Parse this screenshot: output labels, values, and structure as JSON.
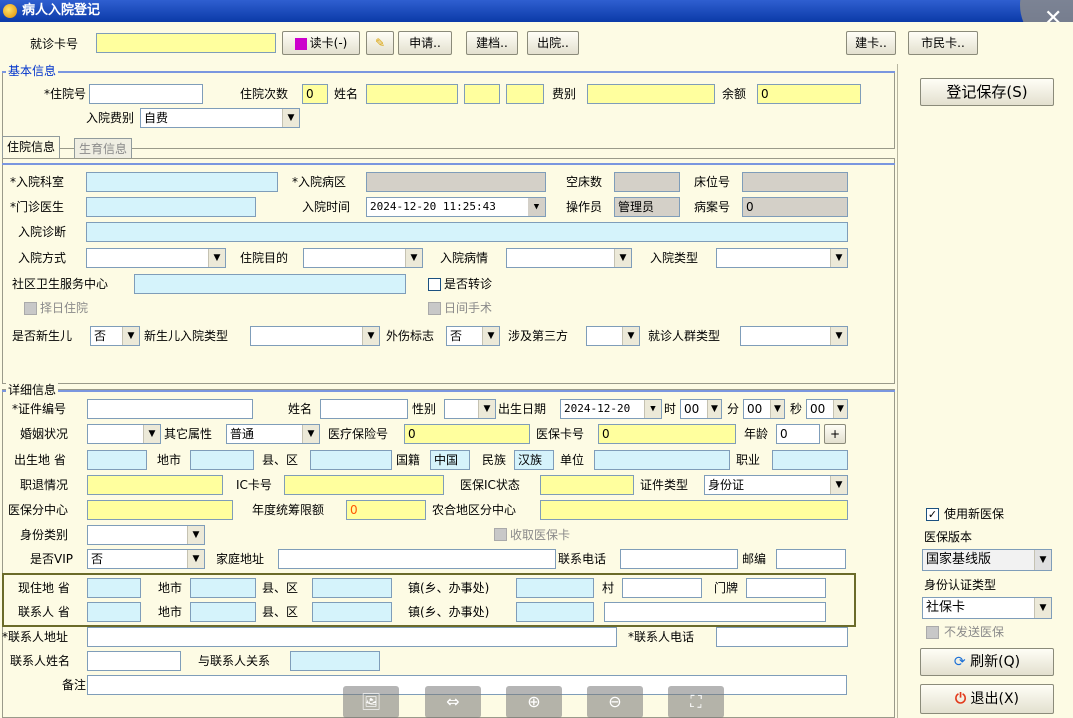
{
  "window": {
    "title": "病人入院登记"
  },
  "top": {
    "card_label": "就诊卡号",
    "card_value": "",
    "read_card": "读卡(-)",
    "apply": "申请..",
    "create_file": "建档..",
    "discharge": "出院..",
    "create_card": "建卡..",
    "citizen_card": "市民卡.."
  },
  "basic": {
    "title": "基本信息",
    "inpatient_no_label": "*住院号",
    "inpatient_no": "",
    "times_label": "住院次数",
    "times": "0",
    "name_label": "姓名",
    "fee_label": "费别",
    "balance_label": "余额",
    "balance": "0",
    "admit_fee_label": "入院费别",
    "admit_fee": "自费"
  },
  "tabs": {
    "hosp": "住院信息",
    "birth": "生育信息"
  },
  "hosp": {
    "dept": "*入院科室",
    "ward": "*入院病区",
    "empty_beds": "空床数",
    "bed_no": "床位号",
    "doctor": "*门诊医生",
    "admit_time_label": "入院时间",
    "admit_time": "2024-12-20 11:25:43",
    "operator_label": "操作员",
    "operator": "管理员",
    "case_no_label": "病案号",
    "case_no": "0",
    "diagnosis": "入院诊断",
    "admit_way": "入院方式",
    "purpose": "住院目的",
    "condition": "入院病情",
    "admit_type": "入院类型",
    "community": "社区卫生服务中心",
    "transfer": "是否转诊",
    "select_day": "择日住院",
    "day_surgery": "日间手术",
    "newborn_label": "是否新生儿",
    "newborn": "否",
    "newborn_type": "新生儿入院类型",
    "injury_label": "外伤标志",
    "injury": "否",
    "third_party": "涉及第三方",
    "crowd_type": "就诊人群类型"
  },
  "detail": {
    "title": "详细信息",
    "cert_no": "*证件编号",
    "name": "姓名",
    "sex": "性别",
    "birth_label": "出生日期",
    "birth": "2024-12-20",
    "hour_label": "时",
    "hour": "00",
    "min_label": "分",
    "min": "00",
    "sec_label": "秒",
    "sec": "00",
    "marital": "婚姻状况",
    "other_attr": "其它属性",
    "other_attr_val": "普通",
    "insurance_no_label": "医疗保险号",
    "insurance_no": "0",
    "card_no_label": "医保卡号",
    "card_no": "0",
    "age_label": "年龄",
    "age": "0",
    "birthplace": "出生地 省",
    "city": "地市",
    "county": "县、区",
    "nation_label": "国籍",
    "nation": "中国",
    "ethnic_label": "民族",
    "ethnic": "汉族",
    "unit": "单位",
    "job": "职业",
    "retire": "职退情况",
    "ic_no": "IC卡号",
    "ic_state": "医保IC状态",
    "cert_type_label": "证件类型",
    "cert_type": "身份证",
    "ins_center": "医保分中心",
    "annual": "年度统筹限额",
    "annual_val": "0",
    "rural_center": "农合地区分中心",
    "id_cat": "身份类别",
    "collect_card": "收取医保卡",
    "vip_label": "是否VIP",
    "vip": "否",
    "home_addr": "家庭地址",
    "phone": "联系电话",
    "zip": "邮编",
    "current": "现住地 省",
    "contact": "联系人 省",
    "street": "镇(乡、办事处)",
    "village": "村",
    "house_no": "门牌",
    "contact_addr": "*联系人地址",
    "contact_phone": "*联系人电话",
    "contact_name": "联系人姓名",
    "relation": "与联系人关系",
    "remark": "备注"
  },
  "right": {
    "save": "登记保存(S)",
    "use_new": "使用新医保",
    "ver_label": "医保版本",
    "ver": "国家基线版",
    "auth_label": "身份认证类型",
    "auth": "社保卡",
    "no_send": "不发送医保",
    "refresh": "刷新(Q)",
    "exit": "退出(X)"
  },
  "zoom": {
    "image": "🖼",
    "fit": "⇔",
    "zoom_in": "⊕",
    "zoom_out": "⊖",
    "full": "⛶"
  },
  "close_x": "✕"
}
